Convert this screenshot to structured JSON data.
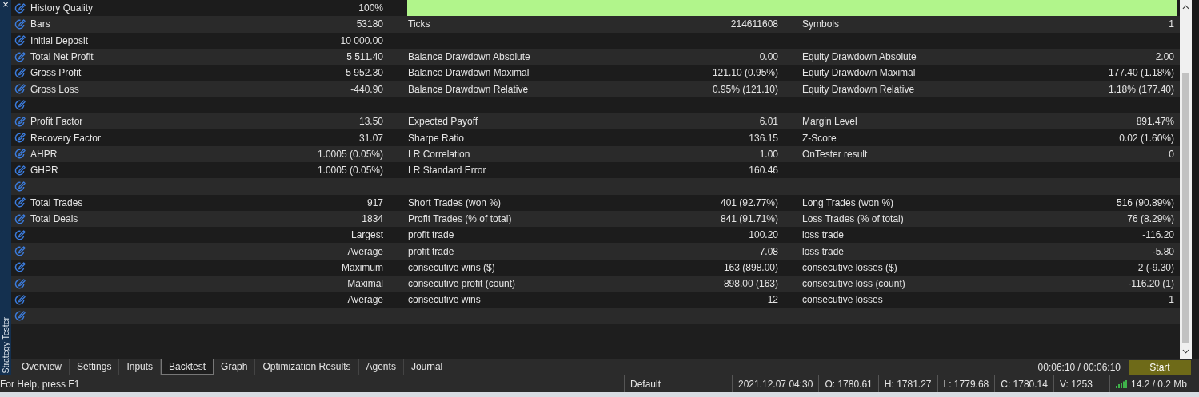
{
  "panel": {
    "title": "Strategy Tester",
    "close": "×"
  },
  "rows": [
    {
      "kind": "quality",
      "name": "History Quality",
      "value": "100%",
      "level": 1
    },
    {
      "kind": "data",
      "name": "Bars",
      "value": "53180",
      "name_2": "Ticks",
      "value_2": "214611608",
      "name_3": "Symbols",
      "value_3": "1"
    },
    {
      "kind": "data",
      "name": "Initial Deposit",
      "value": "10 000.00"
    },
    {
      "kind": "data",
      "name": "Total Net Profit",
      "value": "5 511.40",
      "name_2": "Balance Drawdown Absolute",
      "value_2": "0.00",
      "name_3": "Equity Drawdown Absolute",
      "value_3": "2.00"
    },
    {
      "kind": "data",
      "name": "Gross Profit",
      "value": "5 952.30",
      "name_2": "Balance Drawdown Maximal",
      "value_2": "121.10 (0.95%)",
      "name_3": "Equity Drawdown Maximal",
      "value_3": "177.40 (1.18%)"
    },
    {
      "kind": "data",
      "name": "Gross Loss",
      "value": "-440.90",
      "name_2": "Balance Drawdown Relative",
      "value_2": "0.95% (121.10)",
      "name_3": "Equity Drawdown Relative",
      "value_3": "1.18% (177.40)"
    },
    {
      "kind": "data"
    },
    {
      "kind": "data",
      "name": "Profit Factor",
      "value": "13.50",
      "name_2": "Expected Payoff",
      "value_2": "6.01",
      "name_3": "Margin Level",
      "value_3": "891.47%"
    },
    {
      "kind": "data",
      "name": "Recovery Factor",
      "value": "31.07",
      "name_2": "Sharpe Ratio",
      "value_2": "136.15",
      "name_3": "Z-Score",
      "value_3": "0.02 (1.60%)"
    },
    {
      "kind": "data",
      "name": "AHPR",
      "value": "1.0005 (0.05%)",
      "name_2": "LR Correlation",
      "value_2": "1.00",
      "name_3": "OnTester result",
      "value_3": "0"
    },
    {
      "kind": "data",
      "name": "GHPR",
      "value": "1.0005 (0.05%)",
      "name_2": "LR Standard Error",
      "value_2": "160.46"
    },
    {
      "kind": "data"
    },
    {
      "kind": "data",
      "name": "Total Trades",
      "value": "917",
      "name_2": "Short Trades (won %)",
      "value_2": "401 (92.77%)",
      "name_3": "Long Trades (won %)",
      "value_3": "516 (90.89%)"
    },
    {
      "kind": "data",
      "name": "Total Deals",
      "value": "1834",
      "name_2": "Profit Trades (% of total)",
      "value_2": "841 (91.71%)",
      "name_3": "Loss Trades (% of total)",
      "value_3": "76 (8.29%)"
    },
    {
      "kind": "data",
      "value": "Largest",
      "name_2": "profit trade",
      "value_2": "100.20",
      "name_3": "loss trade",
      "value_3": "-116.20"
    },
    {
      "kind": "data",
      "value": "Average",
      "name_2": "profit trade",
      "value_2": "7.08",
      "name_3": "loss trade",
      "value_3": "-5.80"
    },
    {
      "kind": "data",
      "value": "Maximum",
      "name_2": "consecutive wins ($)",
      "value_2": "163 (898.00)",
      "name_3": "consecutive losses ($)",
      "value_3": "2 (-9.30)"
    },
    {
      "kind": "data",
      "value": "Maximal",
      "name_2": "consecutive profit (count)",
      "value_2": "898.00 (163)",
      "name_3": "consecutive loss (count)",
      "value_3": "-116.20 (1)"
    },
    {
      "kind": "data",
      "value": "Average",
      "name_2": "consecutive wins",
      "value_2": "12",
      "name_3": "consecutive losses",
      "value_3": "1"
    },
    {
      "kind": "data"
    }
  ],
  "tabs": [
    {
      "label": "Overview",
      "selected": false
    },
    {
      "label": "Settings",
      "selected": false
    },
    {
      "label": "Inputs",
      "selected": false
    },
    {
      "label": "Backtest",
      "selected": true
    },
    {
      "label": "Graph",
      "selected": false
    },
    {
      "label": "Optimization Results",
      "selected": false
    },
    {
      "label": "Agents",
      "selected": false
    },
    {
      "label": "Journal",
      "selected": false
    }
  ],
  "timer": "00:06:10 / 00:06:10",
  "start_button": "Start",
  "status_bar": {
    "help": "For Help, press F1",
    "profile": "Default",
    "time": "2021.12.07 04:30",
    "open": "O: 1780.61",
    "high": "H: 1781.27",
    "low": "L: 1779.68",
    "close": "C: 1780.14",
    "volume": "V: 1253",
    "traffic": "14.2 / 0.2 Mb"
  }
}
